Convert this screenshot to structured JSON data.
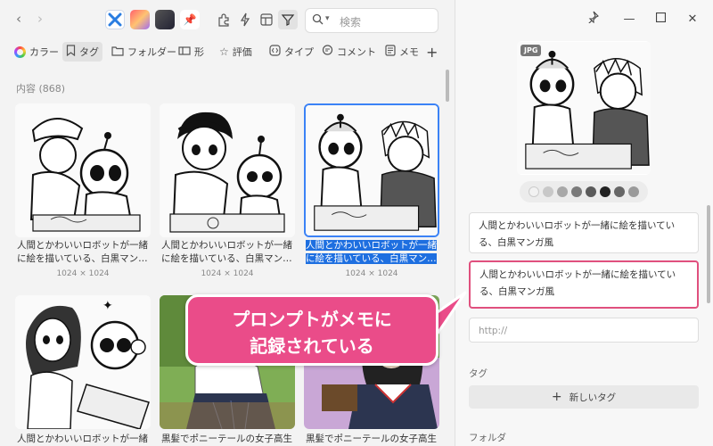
{
  "search": {
    "placeholder": "検索"
  },
  "filters": [
    {
      "label": "カラー",
      "icon": "color-wheel-icon"
    },
    {
      "label": "タグ",
      "icon": "bookmark-icon"
    },
    {
      "label": "フォルダー",
      "icon": "folder-icon"
    },
    {
      "label": "形",
      "icon": "shape-icon"
    },
    {
      "label": "評価",
      "icon": "star-icon"
    },
    {
      "label": "タイプ",
      "icon": "file-type-icon"
    },
    {
      "label": "コメント",
      "icon": "comment-icon"
    },
    {
      "label": "メモ",
      "icon": "memo-icon"
    }
  ],
  "content_count": "内容 (868)",
  "cards": [
    {
      "caption": "人間とかわいいロボットが一緒に絵を描いている、白黒マン…",
      "size": "1024 × 1024"
    },
    {
      "caption": "人間とかわいいロボットが一緒に絵を描いている、白黒マン…",
      "size": "1024 × 1024"
    },
    {
      "caption": "人間とかわいいロボットが一緒に絵を描いている、白黒マン…",
      "size": "1024 × 1024"
    },
    {
      "caption": "人間とかわいいロボットが一緒",
      "size": ""
    },
    {
      "caption": "黒髪でポニーテールの女子高生",
      "size": ""
    },
    {
      "caption": "黒髪でポニーテールの女子高生",
      "size": ""
    }
  ],
  "detail": {
    "format_badge": "JPG",
    "swatch_colors": [
      "#f2f2f2",
      "#c8c8c8",
      "#a8a8a8",
      "#7a7a7a",
      "#5a5a5a",
      "#222222",
      "#666666",
      "#9a9a9a"
    ],
    "title": "人間とかわいいロボットが一緒に絵を描いている、白黒マンガ風",
    "memo": "人間とかわいいロボットが一緒に絵を描いている、白黒マンガ風",
    "url_placeholder": "http://",
    "tag_label": "タグ",
    "new_tag": "新しいタグ",
    "folder_label": "フォルダ"
  },
  "callout": {
    "line1": "プロンプトがメモに",
    "line2": "記録されている"
  },
  "colors": {
    "accent": "#ea4c89",
    "selection": "#1e6fe0"
  }
}
